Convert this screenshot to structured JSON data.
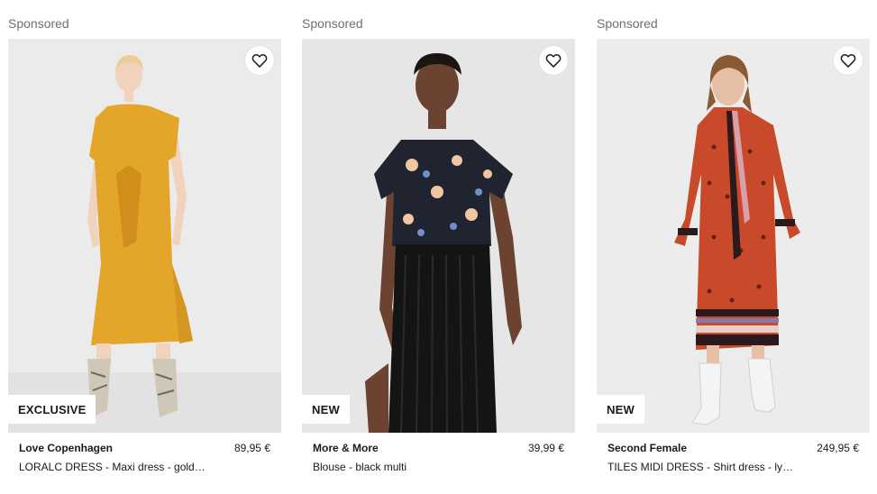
{
  "products": [
    {
      "sponsored_label": "Sponsored",
      "badge": "EXCLUSIVE",
      "brand": "Love Copenhagen",
      "price": "89,95 €",
      "name": "LORALC DRESS - Maxi dress - gold…",
      "image_alt": "Model wearing a golden yellow satin maxi dress with snakeskin boots"
    },
    {
      "sponsored_label": "Sponsored",
      "badge": "NEW",
      "brand": "More & More",
      "price": "39,99 €",
      "name": "Blouse - black multi",
      "image_alt": "Model wearing a black floral blouse and black pleated skirt"
    },
    {
      "sponsored_label": "Sponsored",
      "badge": "NEW",
      "brand": "Second Female",
      "price": "249,95 €",
      "name": "TILES MIDI DRESS - Shirt dress - ly…",
      "image_alt": "Model wearing an orange patterned shirt dress with white cowboy boots"
    }
  ],
  "icons": {
    "wishlist": "heart-outline-icon"
  },
  "colors": {
    "image_bg": "#e8e8e8",
    "dress_gold": "#e3a52a",
    "dress_orange": "#c94a2a",
    "muted_text": "#6f6f6f"
  }
}
